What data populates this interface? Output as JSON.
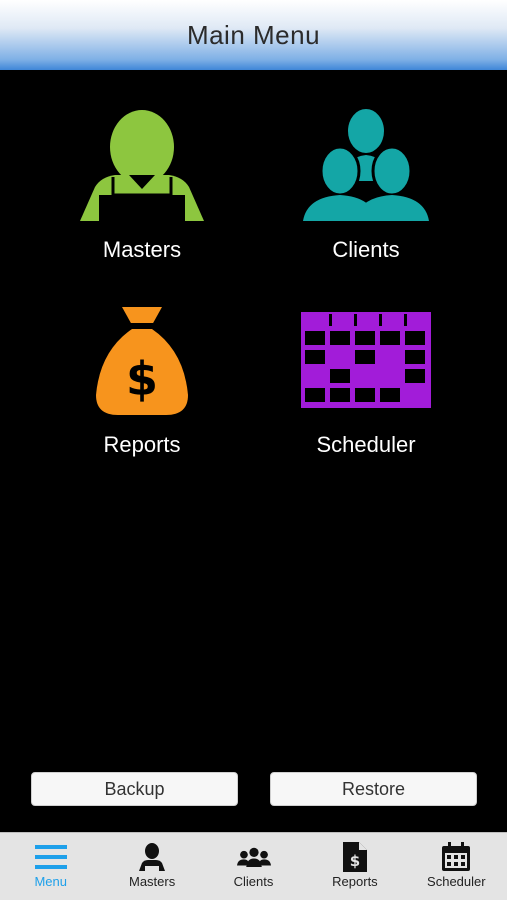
{
  "header": {
    "title": "Main Menu"
  },
  "tiles": [
    {
      "label": "Masters",
      "icon": "master-person-icon",
      "color": "#8dc63f"
    },
    {
      "label": "Clients",
      "icon": "clients-group-icon",
      "color": "#14a6a6"
    },
    {
      "label": "Reports",
      "icon": "money-bag-icon",
      "color": "#f7941d"
    },
    {
      "label": "Scheduler",
      "icon": "calendar-grid-icon",
      "color": "#a21cd9"
    }
  ],
  "actions": {
    "backup_label": "Backup",
    "restore_label": "Restore"
  },
  "tabbar": {
    "active_color": "#1ea0ea",
    "items": [
      {
        "label": "Menu",
        "icon": "hamburger-menu-icon"
      },
      {
        "label": "Masters",
        "icon": "person-icon"
      },
      {
        "label": "Clients",
        "icon": "people-group-icon"
      },
      {
        "label": "Reports",
        "icon": "dollar-document-icon"
      },
      {
        "label": "Scheduler",
        "icon": "calendar-icon"
      }
    ]
  }
}
